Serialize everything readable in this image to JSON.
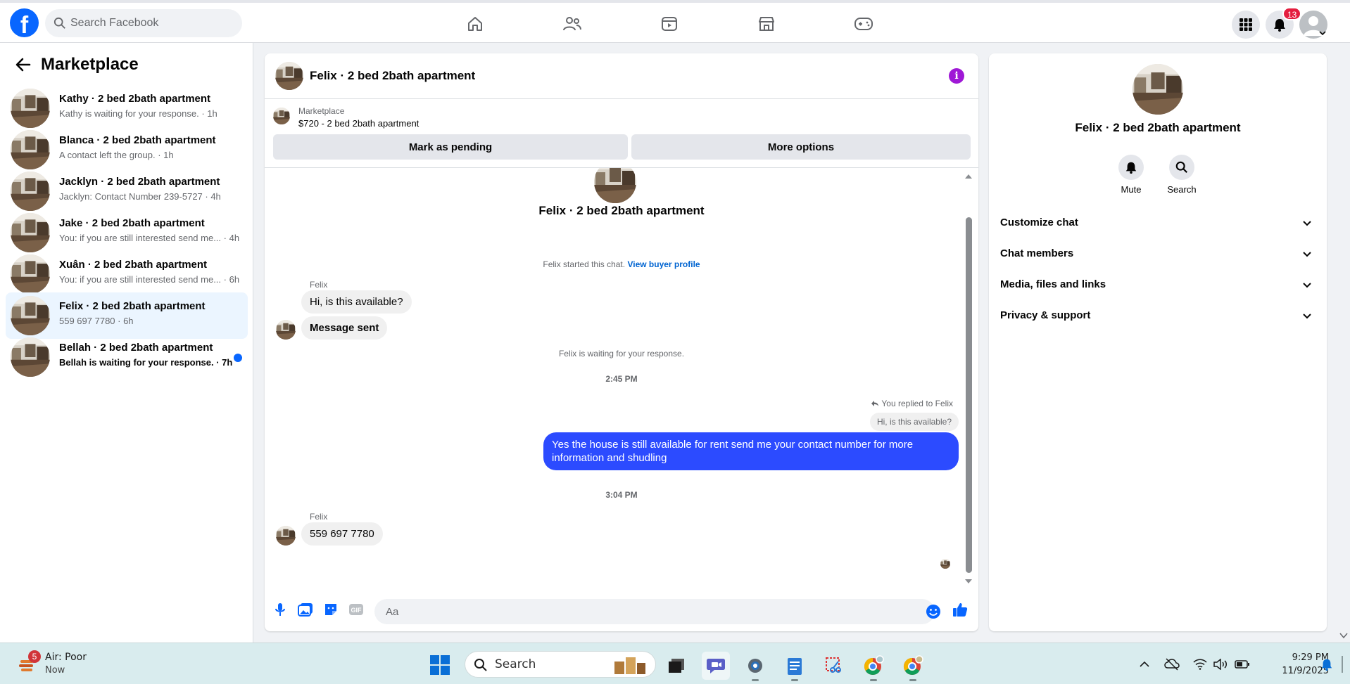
{
  "topbar": {
    "logo": "f",
    "search_placeholder": "Search Facebook",
    "notifications_count": "13",
    "nav_icons": [
      "home-icon",
      "friends-icon",
      "video-icon",
      "marketplace-icon",
      "gaming-icon"
    ]
  },
  "sidebar": {
    "title": "Marketplace",
    "conversations": [
      {
        "title": "Kathy · 2 bed 2bath apartment",
        "subtitle": "Kathy is waiting for your response. · 1h",
        "active": false,
        "unread": false
      },
      {
        "title": "Blanca · 2 bed 2bath apartment",
        "subtitle": "A contact left the group. · 1h",
        "active": false,
        "unread": false
      },
      {
        "title": "Jacklyn · 2 bed 2bath apartment",
        "subtitle": "Jacklyn: Contact Number 239-5727 · 4h",
        "active": false,
        "unread": false
      },
      {
        "title": "Jake · 2 bed 2bath apartment",
        "subtitle": "You: if you are still interested send me... · 4h",
        "active": false,
        "unread": false
      },
      {
        "title": "Xuân · 2 bed 2bath apartment",
        "subtitle": "You: if you are still interested send me... · 6h",
        "active": false,
        "unread": false
      },
      {
        "title": "Felix · 2 bed 2bath apartment",
        "subtitle": "559 697 7780 · 6h",
        "active": true,
        "unread": false
      },
      {
        "title": "Bellah · 2 bed 2bath apartment",
        "subtitle": "Bellah is waiting for your response. · 7h",
        "active": false,
        "unread": true
      }
    ]
  },
  "chat": {
    "title": "Felix · 2 bed 2bath apartment",
    "marketplace_label": "Marketplace",
    "listing": "$720 - 2 bed 2bath apartment",
    "mark_pending": "Mark as pending",
    "more_options": "More options",
    "header_name": "Felix · 2 bed 2bath apartment",
    "started_text": "Felix started this chat.",
    "view_profile": "View buyer profile",
    "sender_name": "Felix",
    "msg1": "Hi, is this available?",
    "msg2": "Message sent",
    "waiting": "Felix is waiting for your response.",
    "time1": "2:45 PM",
    "reply_note": "You replied to Felix",
    "reply_quote": "Hi, is this available?",
    "outgoing": "Yes the house is still available for rent send me your contact number for more information and shudling",
    "time2": "3:04 PM",
    "sender_name2": "Felix",
    "msg3": "559 697 7780",
    "composer_placeholder": "Aa"
  },
  "right_panel": {
    "title": "Felix · 2 bed 2bath apartment",
    "mute": "Mute",
    "search": "Search",
    "sections": [
      "Customize chat",
      "Chat members",
      "Media, files and links",
      "Privacy & support"
    ]
  },
  "taskbar": {
    "weather_title": "Air: Poor",
    "weather_sub": "Now",
    "weather_badge": "5",
    "search_placeholder": "Search",
    "time": "9:29 PM",
    "date": "11/9/2025"
  },
  "colors": {
    "brand": "#0866ff",
    "outgoing_bubble": "#2c4bff",
    "info": "#9f18d6",
    "badge": "#e41e3f"
  }
}
